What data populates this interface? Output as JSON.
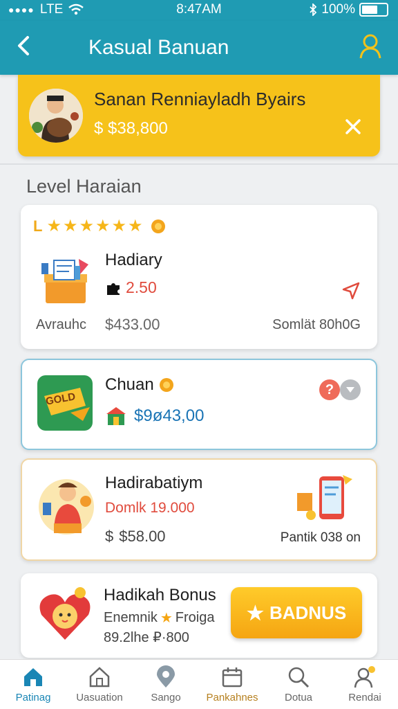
{
  "status": {
    "carrier": "LTE",
    "time": "8:47AM",
    "battery": "100%"
  },
  "header": {
    "title": "Kasual Banuan"
  },
  "banner": {
    "title": "Sanan Renniayladh Byairs",
    "amount": "$38,800",
    "currency_symbol": "$"
  },
  "section": {
    "title": "Level Haraian"
  },
  "cards": [
    {
      "level_mark": "L",
      "stars": 6,
      "title": "Hadiary",
      "rating": "2.50",
      "left_label": "Avrauhc",
      "left_value": "$433.00",
      "right_label": "Somlät 80h0G"
    },
    {
      "title": "Chuan",
      "amount": "$9ø43,00",
      "icon_text": "GOLD"
    },
    {
      "title": "Hadirabatiym",
      "subtitle": "Domlk 19.000",
      "price": "$58.00",
      "currency_symbol": "$",
      "right_label": "Pantik 038 on"
    },
    {
      "title": "Hadikah Bonus",
      "line1": "Enemnik",
      "line1b": "Froiga",
      "line2": "89.2lhe ₽·800",
      "button": "BADNUS"
    }
  ],
  "nav": [
    {
      "label": "Patinag",
      "icon": "home-icon"
    },
    {
      "label": "Uasuation",
      "icon": "house-icon"
    },
    {
      "label": "Sango",
      "icon": "location-icon"
    },
    {
      "label": "Pankahnes",
      "icon": "calendar-icon"
    },
    {
      "label": "Dotua",
      "icon": "search-icon"
    },
    {
      "label": "Rendai",
      "icon": "profile-icon"
    }
  ],
  "colors": {
    "header": "#1f9bb3",
    "banner": "#f6c21a",
    "accent": "#1a86b5",
    "button": "#f5a512"
  }
}
